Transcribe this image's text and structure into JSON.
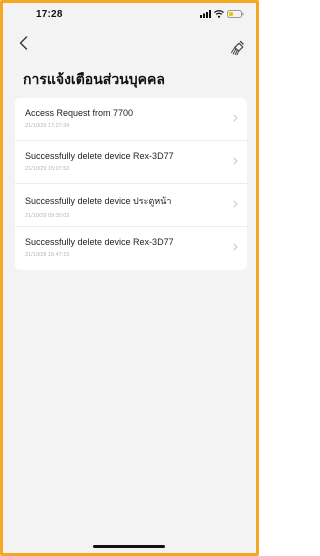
{
  "status_bar": {
    "time": "17:28",
    "icons": [
      "signal-icon",
      "wifi-icon",
      "battery-icon"
    ]
  },
  "nav": {
    "back_icon": "chevron-left-icon",
    "clear_icon": "broom-icon"
  },
  "page": {
    "title": "การแจ้งเตือนส่วนบุคคล"
  },
  "notifications": [
    {
      "title": "Access Request from 7700",
      "time": "21/10/29 17:27:34"
    },
    {
      "title": "Successfully delete device Rex-3D77",
      "time": "21/10/29 15:07:53"
    },
    {
      "title": "Successfully delete device ประตูหน้า",
      "time": "21/10/29 09:30:02"
    },
    {
      "title": "Successfully delete device Rex-3D77",
      "time": "21/10/28 15:47:15"
    }
  ],
  "colors": {
    "frame_border": "#f5a623",
    "background": "#f3f3f3",
    "card": "#ffffff",
    "text_primary": "#222222",
    "text_secondary": "#b5b5b5"
  }
}
